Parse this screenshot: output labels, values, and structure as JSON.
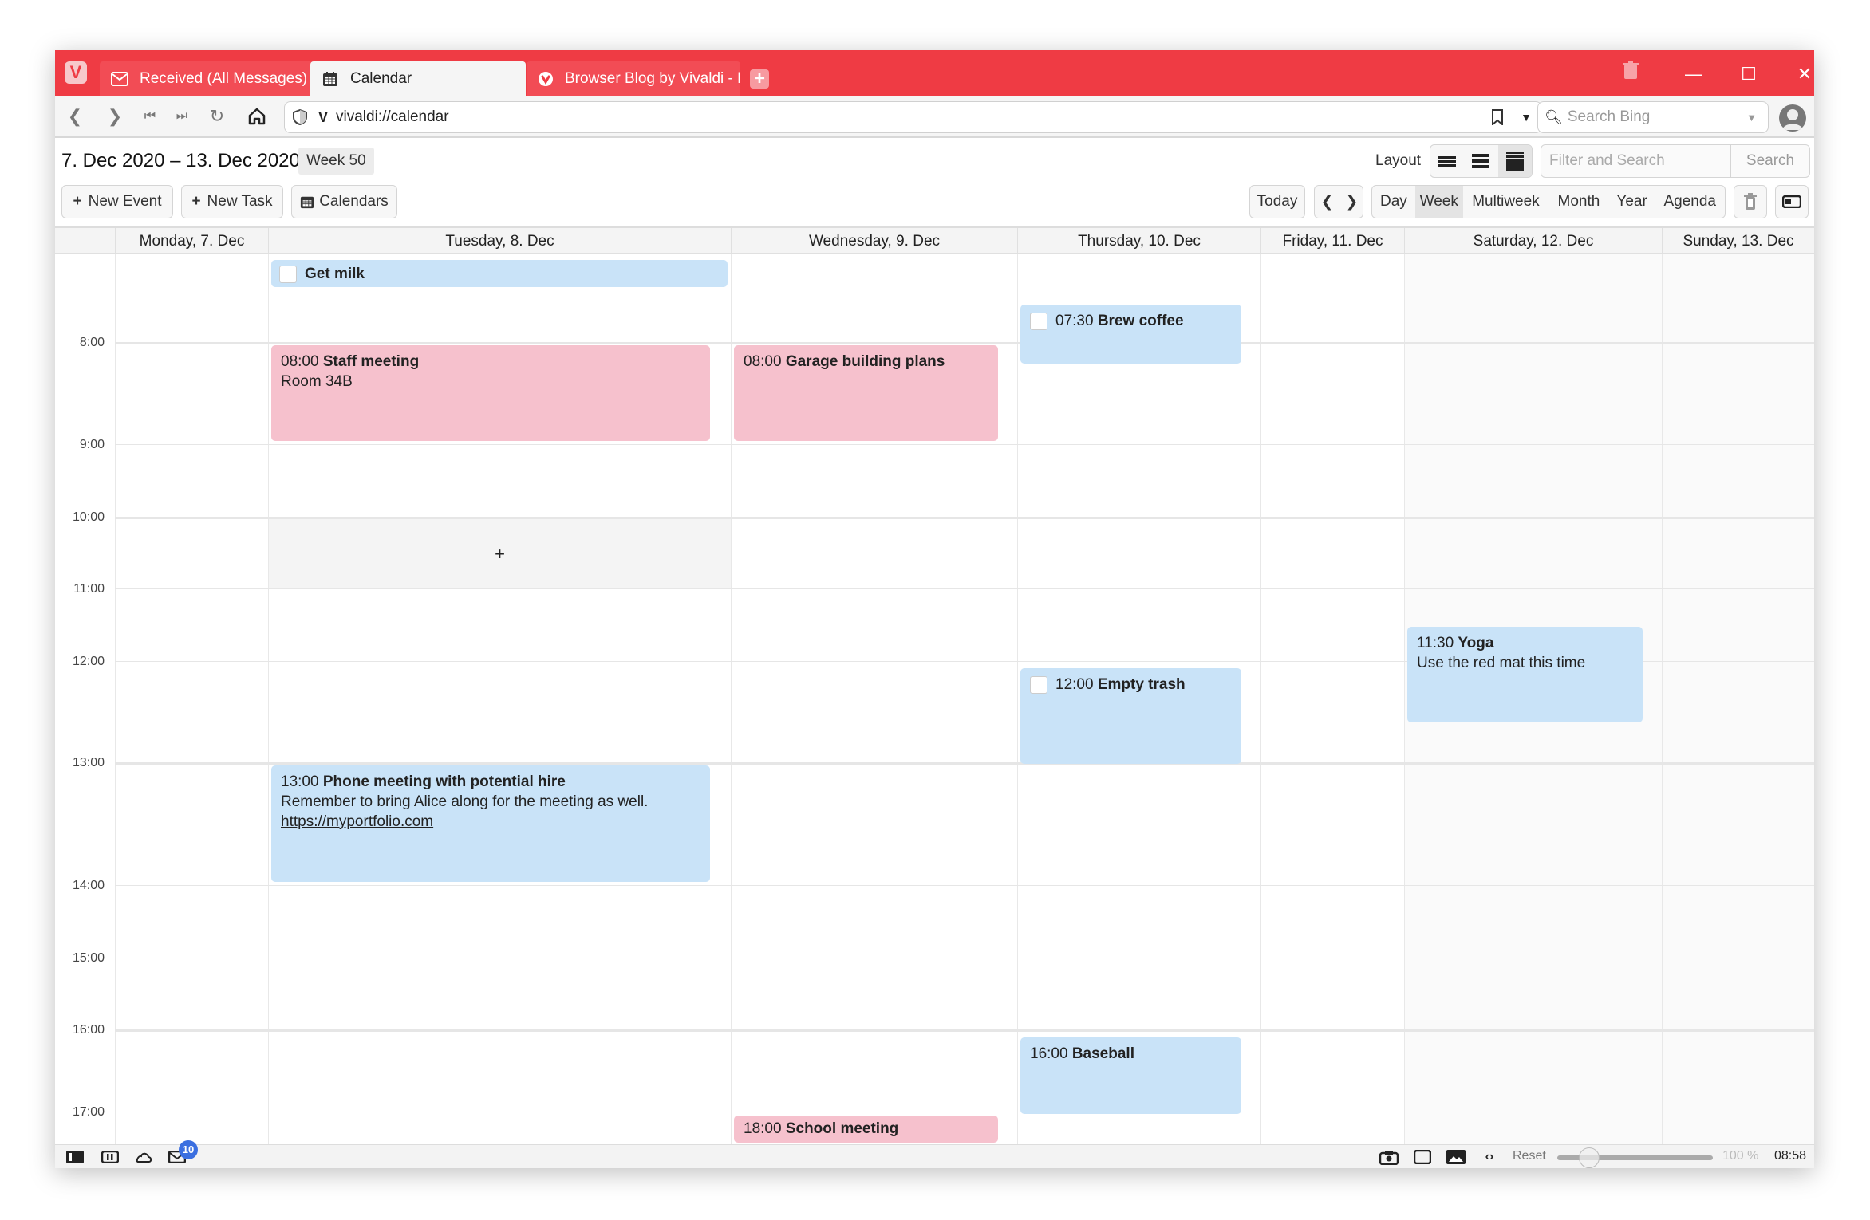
{
  "browser": {
    "tabs": [
      {
        "label": "Received (All Messages)",
        "icon": "mail-icon",
        "active": false
      },
      {
        "label": "Calendar",
        "icon": "calendar-icon",
        "active": true
      },
      {
        "label": "Browser Blog by Vivaldi - N",
        "icon": "vivaldi-icon",
        "active": false
      }
    ],
    "url": "vivaldi://calendar",
    "search_placeholder": "Search Bing",
    "brand_color": "#ef3b44"
  },
  "calendar": {
    "title": "7. Dec 2020 – 13. Dec 2020",
    "week_badge": "Week 50",
    "actions": {
      "new_event": "New Event",
      "new_task": "New Task",
      "calendars": "Calendars"
    },
    "layout_label": "Layout",
    "filter_placeholder": "Filter and Search",
    "search_button": "Search",
    "today_button": "Today",
    "views": [
      "Day",
      "Week",
      "Multiweek",
      "Month",
      "Year",
      "Agenda"
    ],
    "selected_view": "Week",
    "days": [
      "Monday, 7. Dec",
      "Tuesday, 8. Dec",
      "Wednesday, 9. Dec",
      "Thursday, 10. Dec",
      "Friday, 11. Dec",
      "Saturday, 12. Dec",
      "Sunday, 13. Dec"
    ],
    "hours": [
      "8:00",
      "9:00",
      "10:00",
      "11:00",
      "12:00",
      "13:00",
      "14:00",
      "15:00",
      "16:00",
      "17:00"
    ],
    "hover_cell_icon": "+",
    "allday": [
      {
        "day": "Tuesday, 8. Dec",
        "title": "Get milk",
        "task": true,
        "color": "#c9e3f8"
      }
    ],
    "events": [
      {
        "day": "Tuesday, 8. Dec",
        "time": "08:00",
        "title": "Staff meeting",
        "desc": "Room 34B",
        "color": "#f6c1cd"
      },
      {
        "day": "Wednesday, 9. Dec",
        "time": "08:00",
        "title": "Garage building plans",
        "color": "#f6c1cd"
      },
      {
        "day": "Thursday, 10. Dec",
        "time": "07:30",
        "title": "Brew coffee",
        "task": true,
        "color": "#c9e3f8"
      },
      {
        "day": "Saturday, 12. Dec",
        "time": "11:30",
        "title": "Yoga",
        "desc": "Use the red mat this time",
        "color": "#c9e3f8"
      },
      {
        "day": "Thursday, 10. Dec",
        "time": "12:00",
        "title": "Empty trash",
        "task": true,
        "color": "#c9e3f8"
      },
      {
        "day": "Tuesday, 8. Dec",
        "time": "13:00",
        "title": "Phone meeting with potential hire",
        "desc": "Remember to bring Alice along for the meeting as well.",
        "link": "https://myportfolio.com",
        "color": "#c9e3f8"
      },
      {
        "day": "Thursday, 10. Dec",
        "time": "16:00",
        "title": "Baseball",
        "color": "#c9e3f8"
      },
      {
        "day": "Wednesday, 9. Dec",
        "time": "18:00",
        "title": "School meeting",
        "color": "#f6c1cd"
      }
    ]
  },
  "statusbar": {
    "mail_badge": "10",
    "reset_label": "Reset",
    "zoom_level": "100 %",
    "zoom_fraction": 0.14,
    "clock": "08:58"
  }
}
